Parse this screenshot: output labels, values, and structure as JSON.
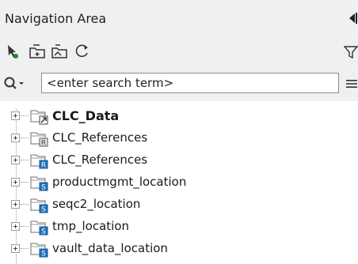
{
  "panel": {
    "title": "Navigation Area"
  },
  "search": {
    "placeholder": "<enter search term>"
  },
  "tree": {
    "items": [
      {
        "label": "CLC_Data",
        "badge": "arrow"
      },
      {
        "label": "CLC_References",
        "badge": "R-gray"
      },
      {
        "label": "CLC_References",
        "badge": "R-blue"
      },
      {
        "label": "productmgmt_location",
        "badge": "S"
      },
      {
        "label": "seqc2_location",
        "badge": "S"
      },
      {
        "label": "tmp_location",
        "badge": "S"
      },
      {
        "label": "vault_data_location",
        "badge": "S"
      }
    ]
  },
  "colors": {
    "panel_bg": "#f0f0f0",
    "tree_bg": "#ffffff",
    "badge_blue": "#1e73be",
    "text": "#1a1a1a"
  },
  "icons": [
    "collapse-left-icon",
    "pointer-icon",
    "new-folder-icon",
    "open-folder-icon",
    "refresh-icon",
    "filter-icon",
    "search-icon",
    "menu-icon",
    "expand-plus-icon",
    "location-folder-icon"
  ]
}
